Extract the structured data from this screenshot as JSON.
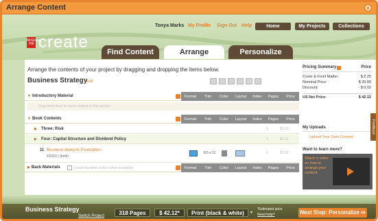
{
  "window": {
    "title": "Arrange Content",
    "close_glyph": "x"
  },
  "header": {
    "logo_badge": "McGraw Hill",
    "logo_text": "create",
    "user_name": "Tonya Marks",
    "links": [
      "My Profile",
      "Sign Out",
      "Help"
    ],
    "buttons": [
      "Home",
      "My Projects",
      "Collections"
    ]
  },
  "tabs": [
    {
      "label": "Find Content",
      "active": false
    },
    {
      "label": "Arrange",
      "active": true
    },
    {
      "label": "Personalize",
      "active": false
    }
  ],
  "main": {
    "instructions": "Arrange the contents of your project by dragging and dropping the items below.",
    "project_title": "Business Strategy",
    "edit_label": "edit",
    "columns": [
      "Format",
      "Trim",
      "Color",
      "Layout",
      "Index",
      "Pages",
      "Price"
    ],
    "intro_section": "Introductory Material",
    "drop_placeholder": "Drag items here to move content to this section",
    "book_section": "Book Contents",
    "chapters": [
      {
        "name": "Three: Risk",
        "index": "1",
        "price": "$0.13"
      },
      {
        "name": "Four: Capital Structure and Dividend Policy",
        "index": "1",
        "price": "$0.13"
      }
    ],
    "item": {
      "number": "11",
      "title": "Business Analysis Foundation",
      "copyright": "©2010 | Smith",
      "trim": "8.5 x 11",
      "index": "1",
      "price": "$0.12"
    },
    "back_section": "Back Materials",
    "back_checkbox_label": "Create dynamic index (when available)"
  },
  "sidebar": {
    "summary_title": "Pricing Summary",
    "price_label": "Price",
    "rows": [
      {
        "label": "Cover & Front Matter:",
        "value": "$ 2.25"
      },
      {
        "label": "Nominal Price:",
        "value": "$ 39.89"
      },
      {
        "label": "Discount:",
        "value": "- $ 0.02"
      }
    ],
    "net_label": "US Net Price:",
    "net_value": "$ 42.12",
    "uploads_title": "My Uploads",
    "upload_link": "Upload Your Own Content",
    "learn_title": "Want to learn more?",
    "video_text": "Watch a video on how to arrange your content.",
    "feedback": "Feedback"
  },
  "footer": {
    "project_title": "Business Strategy",
    "switch_link": "Switch Project",
    "pages": "318 Pages",
    "price": "$ 42.12*",
    "print_option": "Print (black & white)",
    "estimated": "*Estimated price",
    "need_help": "Need help?",
    "next_step": "Next Step: Personalize ⇒"
  }
}
